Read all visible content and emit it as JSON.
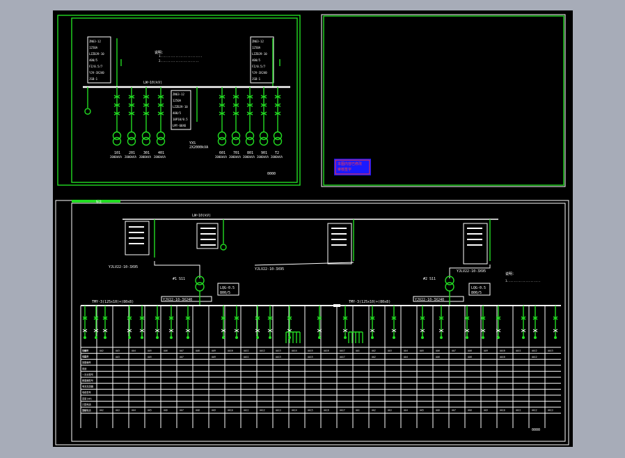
{
  "sheet1": {
    "bus_label": "LW~10(kV)",
    "feeders_left": [
      {
        "no": "101",
        "label": "2000kVA"
      },
      {
        "no": "201",
        "label": "2000kVA"
      },
      {
        "no": "301",
        "label": "2000kVA"
      },
      {
        "no": "401",
        "label": "2000kVA"
      }
    ],
    "feeders_right": [
      {
        "no": "601",
        "label": "2000kVA"
      },
      {
        "no": "701",
        "label": "2000kVA"
      },
      {
        "no": "801",
        "label": "2000kVA"
      },
      {
        "no": "901",
        "label": "2000kVA"
      },
      {
        "no": "T2",
        "label": "2000kVA"
      }
    ],
    "center_transformer": "2X2000kVA",
    "center_no": "YXS",
    "pt_box_lines": [
      "ZN63-12",
      "1250A",
      "LZZBJ9-10",
      "400/5",
      "10P10/0.5",
      "LMY-60X6"
    ],
    "incoming_box_lines": [
      "ZN63-12",
      "1250A",
      "LZZBJ9-10",
      "400/5",
      "FZ/0.5/7",
      "YJV-3X240",
      "JSB-1"
    ],
    "note": "说明：",
    "title_code": "0000"
  },
  "sheet2": {
    "stamp_line1": "本图内容已修改",
    "stamp_line2": "审核签字"
  },
  "sheet3": {
    "header_tag": "标注",
    "hv_bus_label": "LW~10(kV)",
    "hv_cable": "YJLV22-10-3X95",
    "tr1_cable": "YJLV22-10-3X95",
    "tr2_cable": "YJLV22-10-3X95",
    "tr1_no": "#1 S11",
    "tr2_no": "#2 S11",
    "tr1_box": [
      "LQG-0.5",
      "800/5"
    ],
    "tr2_box": [
      "LQG-0.5",
      "800/5"
    ],
    "bus_left": "TMY-3(125X10)+80X8",
    "bus_right": "TMY-3(125X10)+80X8",
    "lv_bus1_label": "TMY-3(125x10)+(80x8)",
    "lv_bus2_label": "TMY-3(125x10)+(80x8)",
    "tr1_out_cable": "YJV22-10-3X240",
    "tr2_out_cable": "YJV22-10-3X240",
    "note": "说明：",
    "title_code": "0000",
    "row_labels": [
      "柜编号",
      "柜型号",
      "回路编号",
      "用途",
      "一次方案号",
      "断路器型号",
      "电流互感器",
      "电缆型号",
      "容量(kW)",
      "计算电流",
      "整定电流"
    ],
    "panels": [
      "AA1",
      "AA2",
      "AA3",
      "AA4",
      "AA5",
      "AA6",
      "AA7",
      "AA8",
      "AA9",
      "AA10",
      "AA11",
      "AA12",
      "AA13",
      "AA14",
      "AA15",
      "AA16",
      "AA17"
    ]
  }
}
